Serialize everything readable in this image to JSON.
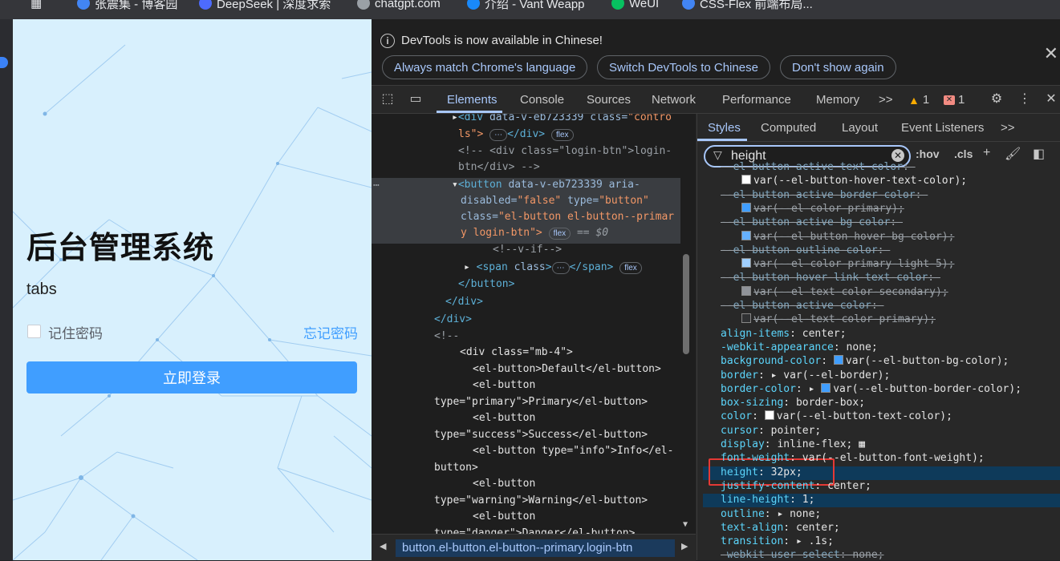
{
  "bookmarks": [
    {
      "label": "张震集 - 博客园",
      "color": "#4285f4"
    },
    {
      "label": "DeepSeek | 深度求索",
      "color": "#4d6bfe"
    },
    {
      "label": "chatgpt.com",
      "color": "#9aa0a6"
    },
    {
      "label": "介绍 - Vant Weapp",
      "color": "#1989fa"
    },
    {
      "label": "WeUI",
      "color": "#07c160"
    },
    {
      "label": "CSS-Flex 前端布局...",
      "color": "#4285f4"
    }
  ],
  "page": {
    "title": "后台管理系统",
    "tabs_text": "tabs",
    "remember_label": "记住密码",
    "forgot_label": "忘记密码",
    "login_label": "立即登录"
  },
  "devtools": {
    "notice": {
      "message": "DevTools is now available in Chinese!",
      "btn_match": "Always match Chrome's language",
      "btn_switch": "Switch DevTools to Chinese",
      "btn_dismiss": "Don't show again"
    },
    "tabs": [
      "Elements",
      "Console",
      "Sources",
      "Network",
      "Performance",
      "Memory"
    ],
    "more": ">>",
    "warn_count": "1",
    "error_count": "1",
    "styles_tabs": [
      "Styles",
      "Computed",
      "Layout",
      "Event Listeners"
    ],
    "filter_value": "height",
    "hov": ":hov",
    "cls": ".cls",
    "breadcrumb": "button.el-button.el-button--primary.login-btn"
  },
  "elements": {
    "line1": [
      "<div",
      " data-v-eb723339",
      " class=",
      "\"contro"
    ],
    "line1b": "ls\">",
    "line1c": "</div>",
    "flex": "flex",
    "c1a": "<!-- <div class=\"login-btn\">login-",
    "c1b": "btn</div> -->",
    "btn_a": [
      "<button",
      " data-v-eb723339",
      " aria-"
    ],
    "btn_b": [
      "disabled=",
      "\"false\"",
      " type=",
      "\"button\""
    ],
    "btn_c": [
      "class=",
      "\"el-button el-button--primar"
    ],
    "btn_d": "y login-btn\">",
    "eq0": "== $0",
    "vif": "<!--v-if-->",
    "span": [
      "<span",
      " class",
      ">",
      "</span>"
    ],
    "close_button": "</button>",
    "close_div1": "</div>",
    "close_div2": "</div>",
    "cstart": "<!--",
    "code": [
      "<div class=\"mb-4\">",
      "<el-button>Default</el-button>",
      "<el-button",
      "type=\"primary\">Primary</el-button>",
      "<el-button",
      "type=\"success\">Success</el-button>",
      "<el-button type=\"info\">Info</el-",
      "button>",
      "<el-button",
      "type=\"warning\">Warning</el-button>",
      "<el-button",
      "type=\"danger\">Danger</el-button>"
    ]
  },
  "styles": [
    {
      "t": "strike",
      "p": "--el-button-active-text-color",
      "v": ""
    },
    {
      "t": "ind",
      "sw": "#ffffff",
      "v": "var(--el-button-hover-text-color);"
    },
    {
      "t": "strike",
      "p": "--el-button-active-border-color",
      "v": ""
    },
    {
      "t": "ind-strike",
      "sw": "#409eff",
      "v": "var(--el-color-primary);"
    },
    {
      "t": "strike",
      "p": "--el-button-active-bg-color",
      "v": ""
    },
    {
      "t": "ind-strike",
      "sw": "#66b1ff",
      "v": "var(--el-button-hover-bg-color);"
    },
    {
      "t": "strike",
      "p": "--el-button-outline-color",
      "v": ""
    },
    {
      "t": "ind-strike",
      "sw": "#a0cfff",
      "v": "var(--el-color-primary-light-5);"
    },
    {
      "t": "strike",
      "p": "--el-button-hover-link-text-color",
      "v": ""
    },
    {
      "t": "ind-strike",
      "sw": "#909399",
      "v": "var(--el-text-color-secondary);"
    },
    {
      "t": "strike",
      "p": "--el-button-active-color",
      "v": ""
    },
    {
      "t": "ind-strike",
      "sw": "#303133",
      "v": "var(--el-text-color-primary);"
    },
    {
      "t": "prop",
      "p": "align-items",
      "v": "center;"
    },
    {
      "t": "prop",
      "p": "-webkit-appearance",
      "v": "none;"
    },
    {
      "t": "prop",
      "p": "background-color",
      "sw": "#409eff",
      "v": "var(--el-button-bg-color);"
    },
    {
      "t": "prop",
      "p": "border",
      "arrow": true,
      "v": "var(--el-border);"
    },
    {
      "t": "prop",
      "p": "border-color",
      "arrow": true,
      "sw": "#409eff",
      "v": "var(--el-button-border-color);"
    },
    {
      "t": "prop",
      "p": "box-sizing",
      "v": "border-box;"
    },
    {
      "t": "prop",
      "p": "color",
      "sw": "#ffffff",
      "v": "var(--el-button-text-color);"
    },
    {
      "t": "prop",
      "p": "cursor",
      "v": "pointer;"
    },
    {
      "t": "prop",
      "p": "display",
      "v": "inline-flex;",
      "grid": true
    },
    {
      "t": "prop",
      "p": "font-weight",
      "v": "var(--el-button-font-weight);"
    },
    {
      "t": "prop-hl",
      "p": "height",
      "v": "32px;"
    },
    {
      "t": "prop",
      "p": "justify-content",
      "v": "center;"
    },
    {
      "t": "prop-hl",
      "p": "line-height",
      "v": "1;"
    },
    {
      "t": "prop",
      "p": "outline",
      "arrow": true,
      "v": "none;"
    },
    {
      "t": "prop",
      "p": "text-align",
      "v": "center;"
    },
    {
      "t": "prop",
      "p": "transition",
      "arrow": true,
      "v": ".1s;"
    },
    {
      "t": "strike",
      "p": "-webkit-user-select",
      "v": "none;"
    }
  ]
}
